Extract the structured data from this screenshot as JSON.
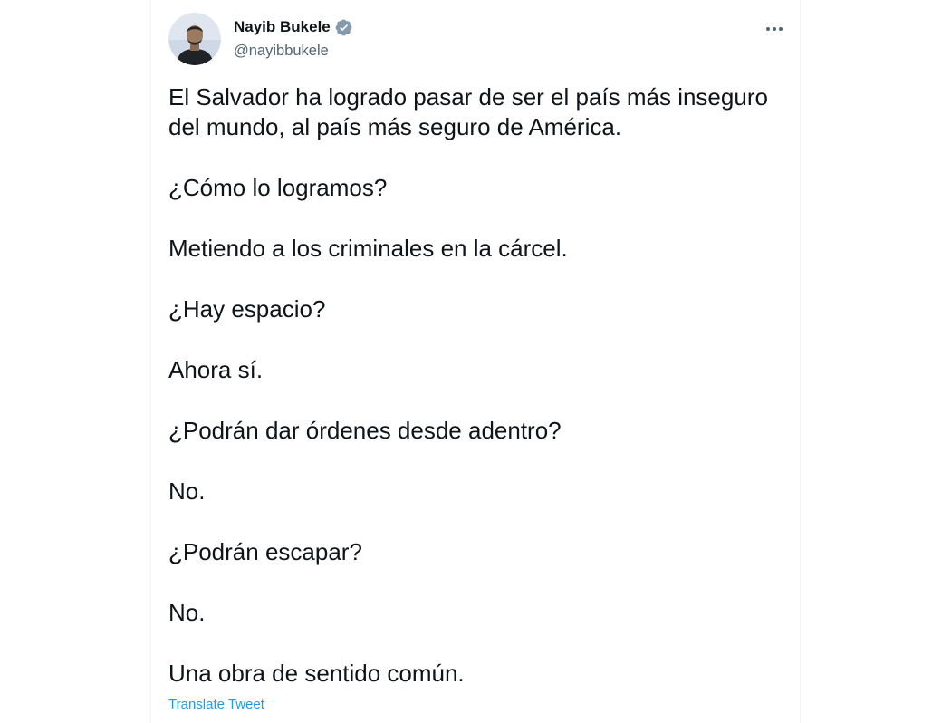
{
  "author": {
    "name": "Nayib Bukele",
    "handle": "@nayibbukele",
    "verified": true
  },
  "icons": {
    "verified": "verified-badge-icon",
    "more": "more-options-icon"
  },
  "colors": {
    "text": "#0f1419",
    "secondary": "#536471",
    "link": "#1d9bf0",
    "verified_badge": "#829aab"
  },
  "tweet": {
    "lines": [
      "El Salvador ha logrado pasar de ser el país más inseguro del mundo, al país más seguro de América.",
      "¿Cómo lo logramos?",
      "Metiendo a los criminales en la cárcel.",
      "¿Hay espacio?",
      "Ahora sí.",
      "¿Podrán dar órdenes desde adentro?",
      "No.",
      "¿Podrán escapar?",
      "No.",
      "Una obra de sentido común."
    ],
    "translate_label": "Translate Tweet"
  }
}
